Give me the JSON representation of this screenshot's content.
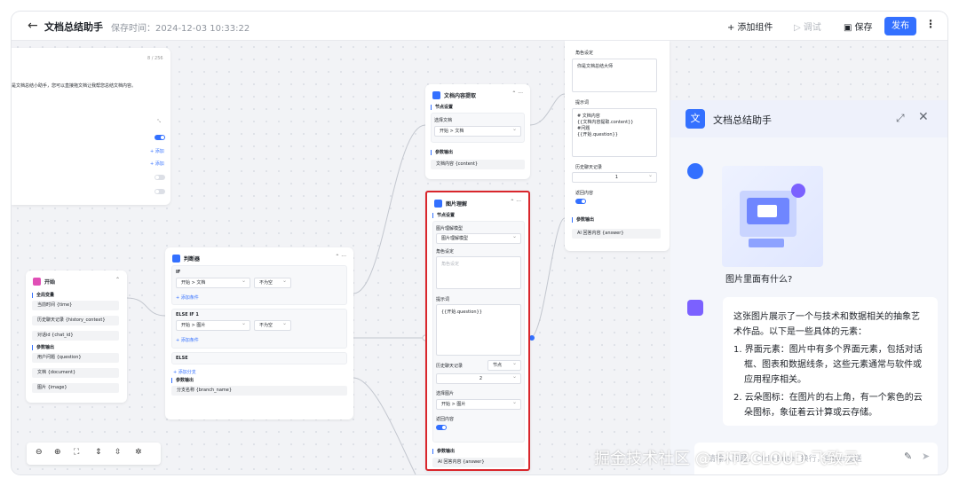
{
  "topbar": {
    "title": "文档总结助手",
    "saved_time": "保存时间：2024-12-03 10:33:22",
    "add_component": "添加组件",
    "test": "调试",
    "save": "保存",
    "publish": "发布"
  },
  "left_partial": {
    "counter": "8 / 256",
    "desc": "是文档总结小助手，您可以直接拖文档让我帮您总结文档内容。",
    "add1": "+ 添加",
    "add2": "+ 添加"
  },
  "start_node": {
    "title": "开始",
    "sec_global": "全局变量",
    "fields": [
      "当前时间 {time}",
      "历史聊天记录 {history_context}",
      "对话id {chat_id}"
    ],
    "sec_params": "参数输出",
    "params": [
      "用户问题 {question}",
      "文档 {document}",
      "图片 {image}"
    ]
  },
  "judge_node": {
    "title": "判断器",
    "if_label": "IF",
    "if_field": "开始 > 文档",
    "if_op": "不为空",
    "add_cond1": "+ 添加条件",
    "elseif_label": "ELSE IF 1",
    "elseif_field": "开始 > 图片",
    "elseif_op": "不为空",
    "add_cond2": "+ 添加条件",
    "else_label": "ELSE",
    "add_branch": "+ 添加分支",
    "sec_params": "参数输出",
    "param": "分支名称 {branch_name}"
  },
  "doc_node": {
    "title": "文档内容提取",
    "sec_setting": "节点设置",
    "select_label": "选择文档",
    "select_value": "开始 > 文档",
    "sec_params": "参数输出",
    "param": "文档内容 {content}"
  },
  "image_node": {
    "title": "图片理解",
    "sec_setting": "节点设置",
    "model_label": "图片理解模型",
    "model_value": "图片理解模型",
    "role_label": "角色设定",
    "role_placeholder": "角色设定",
    "prompt_label": "提示词",
    "prompt_value": "{{开始.question}}",
    "history_label": "历史聊天记录",
    "history_unit": "节点",
    "history_value": "2",
    "image_label": "选择图片",
    "image_value": "开始 > 图片",
    "return_label": "返回内容",
    "sec_params": "参数输出",
    "param": "AI 回答内容 {answer}",
    "highlight_color": "#d9262c"
  },
  "ai_node": {
    "role_label": "角色设定",
    "role_value": "你是文档总结大师",
    "prompt_label": "提示词",
    "prompt_value": "# 文档内容\n{{文档内容提取.content}}\n#问题\n{{开始.question}}",
    "history_label": "历史聊天记录",
    "history_value": "1",
    "return_label": "返回内容",
    "sec_params": "参数输出",
    "param": "AI 回答内容 {answer}"
  },
  "chat": {
    "logo_char": "文",
    "title": "文档总结助手",
    "user_question": "图片里面有什么?",
    "answer_intro": "这张图片展示了一个与技术和数据相关的抽象艺术作品。以下是一些具体的元素：",
    "answer_items": [
      "1. 界面元素：图片中有多个界面元素，包括对话框、图表和数据线条，这些元素通常与软件或应用程序相关。",
      "2. 云朵图标：在图片的右上角，有一个紫色的云朵图标，象征着云计算或云存储。"
    ],
    "input_placeholder": "请输入问题，Ctrl+Enter 换行，Enter发送"
  },
  "watermark": "掘金技术社区 @ FIT2CLOUD 飞致云",
  "colors": {
    "accent": "#3370ff",
    "highlight": "#d9262c"
  }
}
